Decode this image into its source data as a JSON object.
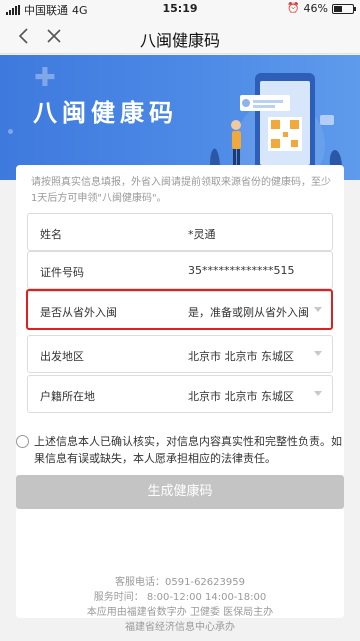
{
  "status_bar": {
    "carrier": "中国联通",
    "network": "4G",
    "time": "15:19",
    "battery": "46%",
    "battery_level": 0.46
  },
  "nav": {
    "title": "八闽健康码"
  },
  "banner": {
    "title": "八闽健康码"
  },
  "form": {
    "notice": "请按照真实信息填报，外省入闽请提前领取来源省份的健康码，至少1天后方可申领\"八闽健康码\"。",
    "fields": [
      {
        "label": "姓名",
        "value": "*灵通"
      },
      {
        "label": "证件号码",
        "value": "35*************515"
      },
      {
        "label": "是否从省外入闽",
        "value": "是，准备或刚从省外入闽"
      },
      {
        "label": "出发地区",
        "value": "北京市 北京市 东城区"
      },
      {
        "label": "户籍所在地",
        "value": "北京市 北京市 东城区"
      }
    ],
    "agreement": "上述信息本人已确认核实，对信息内容真实性和完整性负责。如果信息有误或缺失，本人愿承担相应的法律责任。",
    "submit_label": "生成健康码"
  },
  "footer": {
    "hotline": "客服电话：0591-62623959",
    "hours": "服务时间：  8:00-12:00 14:00-18:00",
    "provider": "本应用由福建省数字办  卫健委  医保局主办",
    "operator": "福建省经济信息中心承办"
  },
  "colors": {
    "banner": "#4d8ae6",
    "highlight": "#e02020",
    "button_disabled": "#c4c4c4"
  },
  "icons": [
    "back-icon",
    "close-icon",
    "signal-icon",
    "alarm-icon",
    "battery-icon"
  ]
}
